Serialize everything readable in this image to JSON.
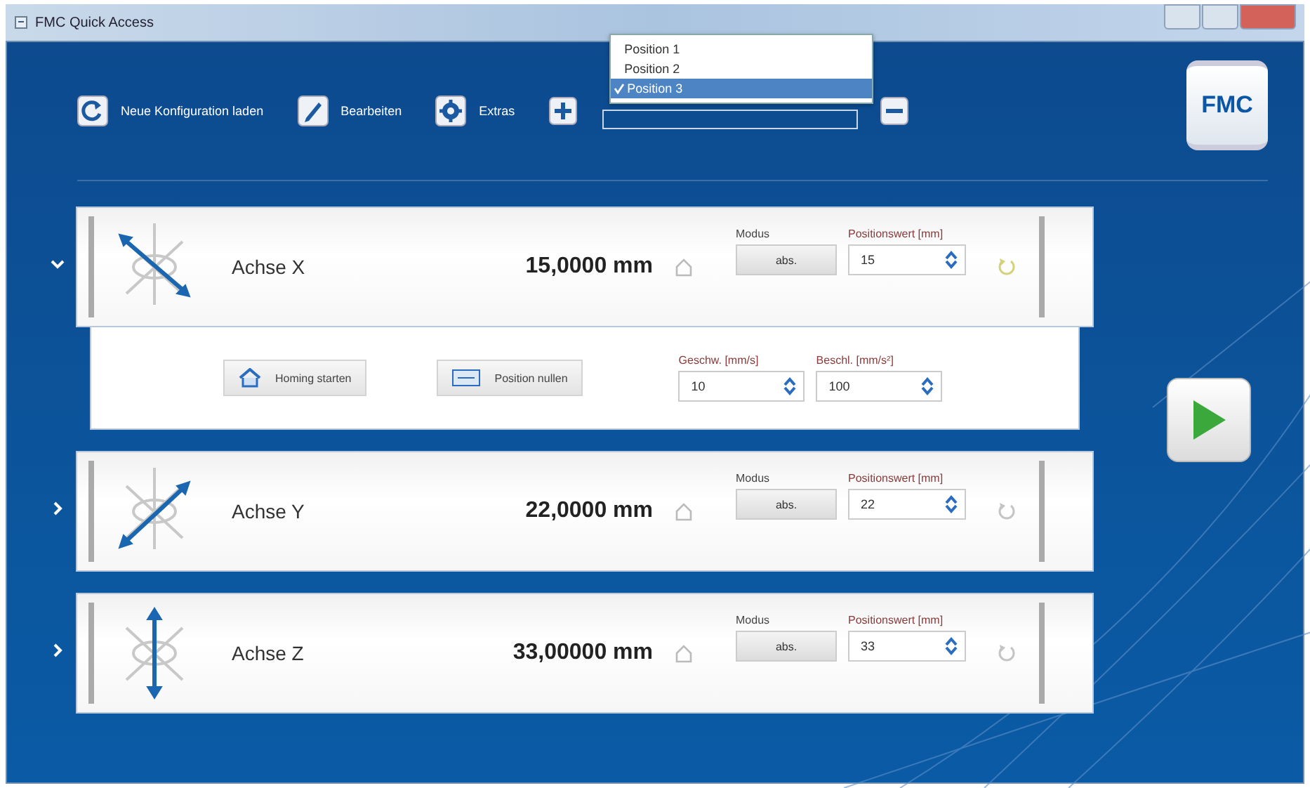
{
  "window": {
    "title": "FMC Quick Access"
  },
  "toolbar": [
    {
      "kind": "reload",
      "label": "Neue Konfiguration laden"
    },
    {
      "kind": "edit",
      "label": "Bearbeiten"
    },
    {
      "kind": "gear",
      "label": "Extras"
    }
  ],
  "position_select": {
    "expanded": true,
    "options": [
      {
        "label": "Position 1",
        "selected": false
      },
      {
        "label": "Position 2",
        "selected": false
      },
      {
        "label": "Position 3",
        "selected": true
      }
    ]
  },
  "logo": "FMC",
  "axes": [
    {
      "name": "Achse X",
      "kind": "x",
      "expanded": true,
      "reading": "15,0000 mm",
      "mode_label": "Modus",
      "mode": "abs.",
      "value_label": "Positionswert [mm]",
      "value": "15",
      "details": {
        "homing": "Homing starten",
        "zero": "Position nullen",
        "speed_label": "Geschw. [mm/s]",
        "speed": "10",
        "accel_label": "Beschl. [mm/s²]",
        "accel": "100"
      }
    },
    {
      "name": "Achse Y",
      "kind": "y",
      "expanded": false,
      "reading": "22,0000 mm",
      "mode_label": "Modus",
      "mode": "abs.",
      "value_label": "Positionswert [mm]",
      "value": "22"
    },
    {
      "name": "Achse Z",
      "kind": "z",
      "expanded": false,
      "reading": "33,00000 mm",
      "mode_label": "Modus",
      "mode": "abs.",
      "value_label": "Positionswert [mm]",
      "value": "33"
    }
  ]
}
